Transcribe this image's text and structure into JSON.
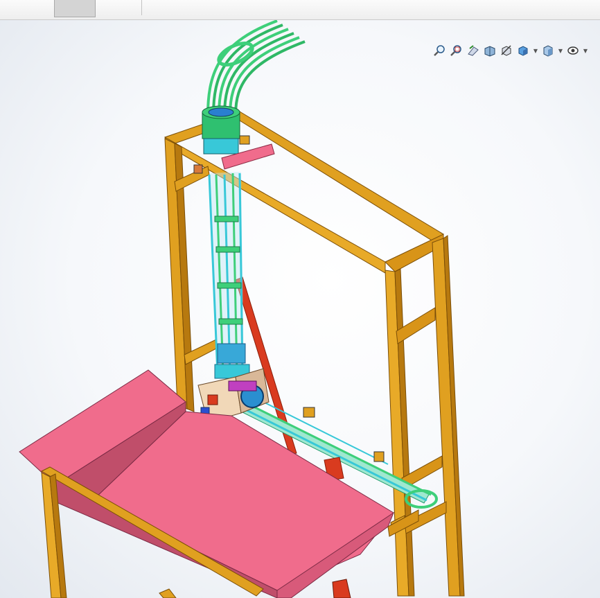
{
  "ribbon": {
    "left_tab_label": "",
    "chinese_tab_label": "",
    "active_tab_label": "",
    "spec_tab_label": ""
  },
  "heads_up_toolbar": {
    "tools": [
      {
        "icon": "zoom-to-fit-icon"
      },
      {
        "icon": "zoom-to-area-icon"
      },
      {
        "icon": "previous-view-icon"
      },
      {
        "icon": "section-view-icon"
      },
      {
        "icon": "view-orientation-icon"
      },
      {
        "icon": "display-style-icon"
      },
      {
        "icon": "hide-show-items-icon"
      },
      {
        "icon": "edit-appearance-icon"
      }
    ]
  },
  "colors": {
    "frame": "#e0a020",
    "frame_dark": "#b7790f",
    "hopper": "#f06c8c",
    "hopper_dark": "#c04e6a",
    "tube_green": "#3ecf7a",
    "tube_cyan": "#38c8d8",
    "rod_red": "#d93b1f"
  }
}
